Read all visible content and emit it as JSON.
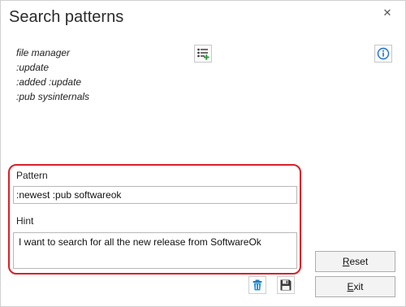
{
  "window": {
    "title": "Search patterns",
    "close_glyph": "✕"
  },
  "patterns": [
    "file manager",
    ":update",
    ":added :update",
    ":pub sysinternals"
  ],
  "icons": {
    "list_add": "list-add-icon",
    "info": "info-icon",
    "delete": "trash-icon",
    "save": "floppy-disk-icon"
  },
  "form": {
    "pattern_label": "Pattern",
    "pattern_value": ":newest :pub softwareok",
    "hint_label": "Hint",
    "hint_value": "I want to search for all the new release from SoftwareOk"
  },
  "buttons": {
    "reset_mnemonic": "R",
    "reset_rest": "eset",
    "exit_mnemonic": "E",
    "exit_rest": "xit"
  },
  "colors": {
    "highlight_border": "#d9202a",
    "accent_green": "#2e9e3e",
    "info_blue": "#1e6fd6"
  }
}
